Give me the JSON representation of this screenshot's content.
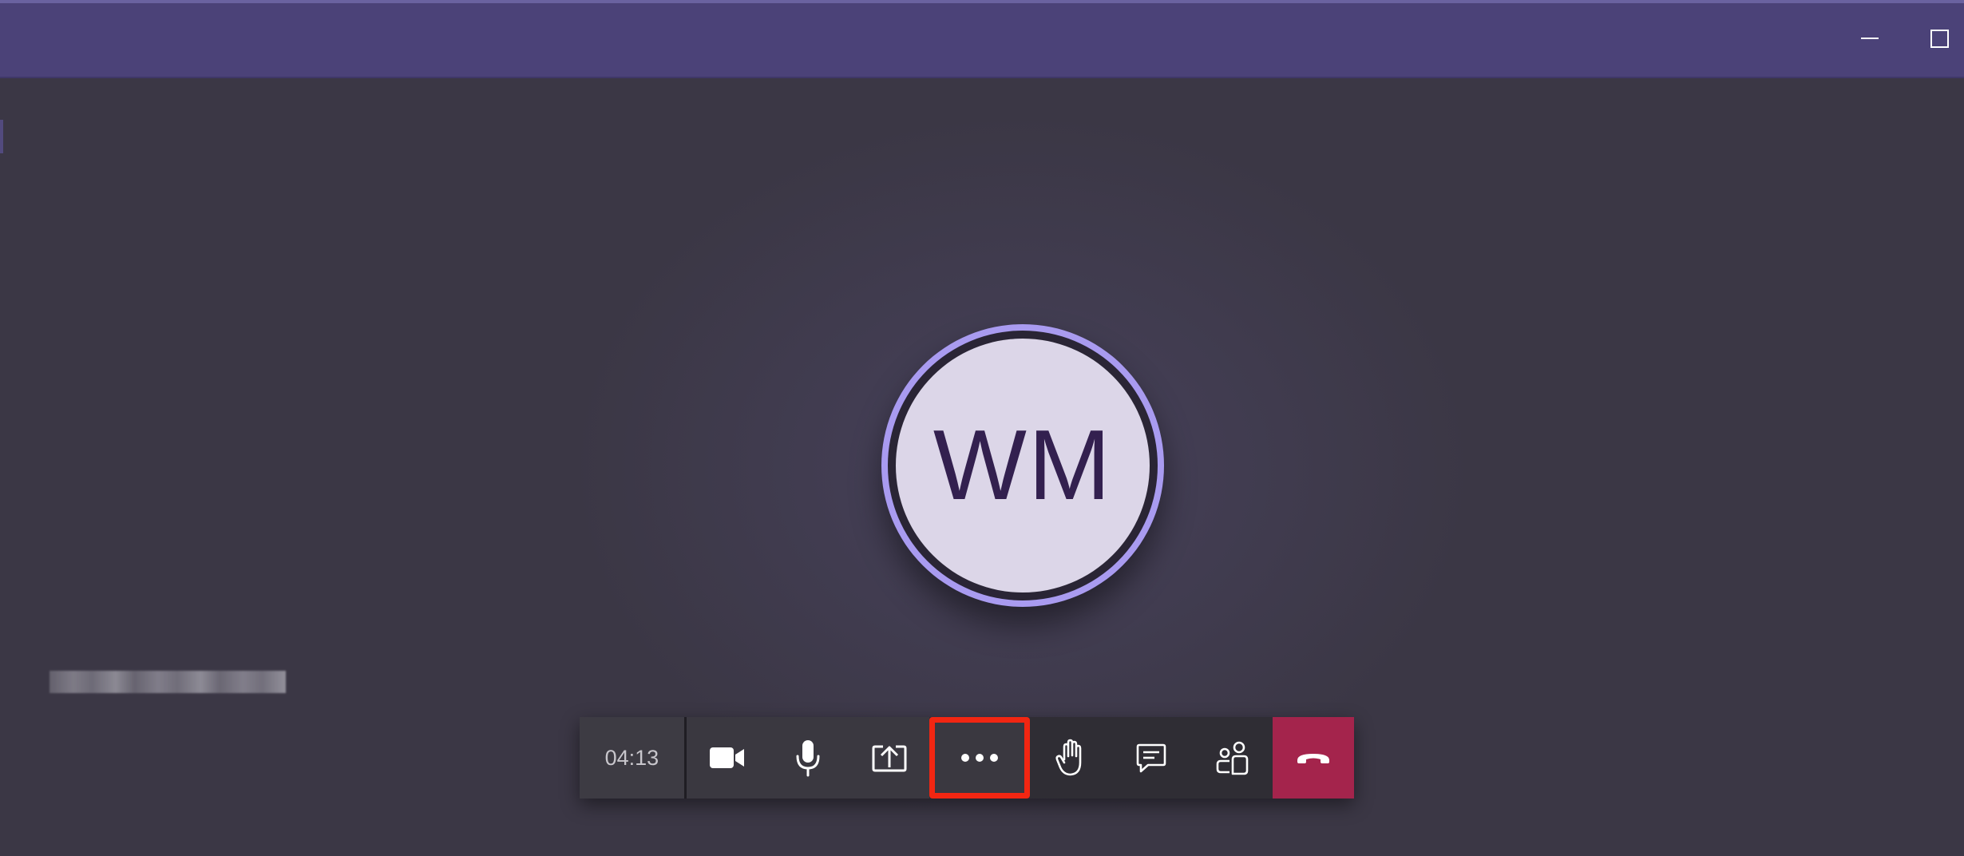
{
  "window": {
    "controls": {
      "minimize_icon": "minimize-icon",
      "maximize_icon": "maximize-icon"
    }
  },
  "participant": {
    "initials": "WM",
    "ring_color": "#a99bf0",
    "avatar_color": "#dcd6e8",
    "initials_color": "#33204f"
  },
  "call_controls": {
    "timer": "04:13",
    "buttons": [
      {
        "name": "camera-button",
        "icon": "video-camera-icon"
      },
      {
        "name": "microphone-button",
        "icon": "microphone-icon"
      },
      {
        "name": "share-screen-button",
        "icon": "share-tray-icon"
      },
      {
        "name": "more-actions-button",
        "icon": "more-dots-icon",
        "highlighted": true
      },
      {
        "name": "raise-hand-button",
        "icon": "hand-icon"
      },
      {
        "name": "chat-button",
        "icon": "chat-icon"
      },
      {
        "name": "participants-button",
        "icon": "people-icon"
      },
      {
        "name": "hang-up-button",
        "icon": "phone-hangup-icon",
        "color": "#a4244c"
      }
    ],
    "highlight_color": "#f22612"
  },
  "colors": {
    "titlebar": "#4b4278",
    "stage_background": "#3b3745",
    "callbar": "#2f2d34"
  }
}
